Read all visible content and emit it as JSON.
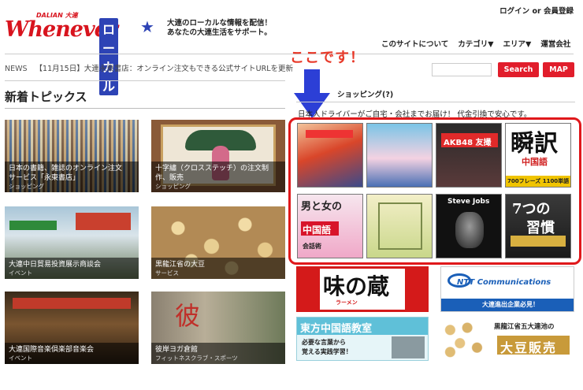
{
  "header": {
    "logo_main": "Whenever",
    "logo_sub": "DALIAN 大連",
    "logo_local": "ローカル",
    "tagline_1": "大連のローカルな情報を配信！",
    "tagline_2": "あなたの大連生活をサポート。",
    "login": "ログイン or 会員登録"
  },
  "nav": [
    "このサイトについて",
    "カテゴリ▼",
    "エリア▼",
    "運営会社"
  ],
  "annotation": "ここです！",
  "news": {
    "label": "NEWS",
    "text": "【11月15日】大連永東書店：オンライン注文もできる公式サイトURLを更新"
  },
  "search": {
    "placeholder": "",
    "button": "Search",
    "map_button": "MAP"
  },
  "topics": {
    "title": "新着トピックス",
    "items": [
      {
        "title_1": "日本の書籍、雑誌のオンライン注文",
        "title_2": "サービス「永東書店」",
        "category": "ショッピング"
      },
      {
        "title_1": "十字繡（クロスステッチ）の注文制",
        "title_2": "作、販売",
        "category": "ショッピング"
      },
      {
        "title_1": "大連中日貿易投資展示商談会",
        "title_2": "",
        "category": "イベント"
      },
      {
        "title_1": "黒龍江省の大豆",
        "title_2": "",
        "category": "サービス"
      },
      {
        "title_1": "大連国際音楽倶楽部音楽会",
        "title_2": "",
        "category": "イベント"
      },
      {
        "title_1": "彼岸ヨガ倉館",
        "title_2": "",
        "category": "フィットネスクラブ・スポーツ"
      }
    ]
  },
  "shop": {
    "title": "ショッピング(?)",
    "desc": "日本人ドライバーがご自宅・会社までお届け！ 代金引換で安心です。",
    "books": {
      "akb": "AKB48 友撮",
      "shun": "瞬訳",
      "shun_sub": "中国語",
      "shun_price": "700フレーズ 1100単語",
      "otoko": "男と女の",
      "chuugokugo": "中国語",
      "kaiwa": "会話術",
      "jobs": "Steve Jobs",
      "nana": "7つの",
      "shuukan": "習慣"
    }
  },
  "banners": {
    "ajinokura": "味の蔵",
    "ajinokura_sub": "ラーメン",
    "ntt": "NTT Communications",
    "ntt_sub": "大連進出企業必見！",
    "toho": "東方中国語教室",
    "toho_sub_1": "必要な言葉から",
    "toho_sub_2": "覚える実践学習！",
    "daizu_1": "黒龍江省五大連池の",
    "daizu_2": "大豆販売"
  },
  "colors": {
    "brand_red": "#d8141e",
    "brand_blue": "#2d43b5",
    "frame_red": "#e0181b"
  }
}
